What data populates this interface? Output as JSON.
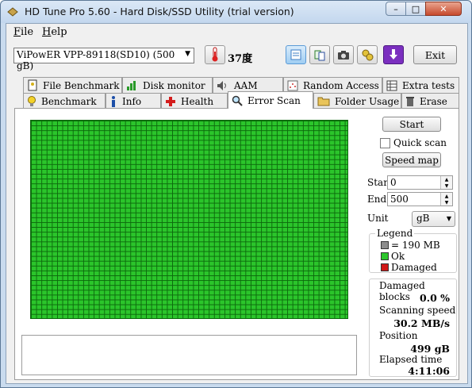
{
  "window": {
    "title": "HD Tune Pro 5.60 - Hard Disk/SSD Utility (trial version)",
    "controls": {
      "minimize": "–",
      "maximize": "□",
      "close": "✕"
    }
  },
  "menu": {
    "file": "File",
    "help": "Help"
  },
  "toolbar": {
    "drive": "ViPowER VPP-89118(SD10) (500 gB)",
    "temperature": "37度",
    "exit_label": "Exit",
    "icons": [
      "thermometer-icon",
      "copy-info-icon",
      "copy-screen-icon",
      "camera-icon",
      "options-icon",
      "download-icon"
    ]
  },
  "tabs": {
    "row1": [
      "File Benchmark",
      "Disk monitor",
      "AAM",
      "Random Access",
      "Extra tests"
    ],
    "row2": [
      "Benchmark",
      "Info",
      "Health",
      "Error Scan",
      "Folder Usage",
      "Erase"
    ],
    "active": "Error Scan"
  },
  "scan": {
    "start_label": "Start",
    "quick_scan_label": "Quick scan",
    "quick_scan_checked": false,
    "speed_map_label": "Speed map",
    "start_field_label": "Start",
    "start_value": "0",
    "end_field_label": "End",
    "end_value": "500",
    "unit_label": "Unit",
    "unit_value": "gB"
  },
  "legend": {
    "title": "Legend",
    "block_size": "= 190 MB",
    "ok": "Ok",
    "damaged": "Damaged",
    "colors": {
      "block": "#8c8c8c",
      "ok": "#2bc52b",
      "damaged": "#d01818"
    }
  },
  "stats": {
    "damaged_blocks_label": "Damaged blocks",
    "damaged_blocks_value": "0.0 %",
    "scanning_speed_label": "Scanning speed",
    "scanning_speed_value": "30.2 MB/s",
    "position_label": "Position",
    "position_value": "499 gB",
    "elapsed_label": "Elapsed time",
    "elapsed_value": "4:11:06"
  }
}
